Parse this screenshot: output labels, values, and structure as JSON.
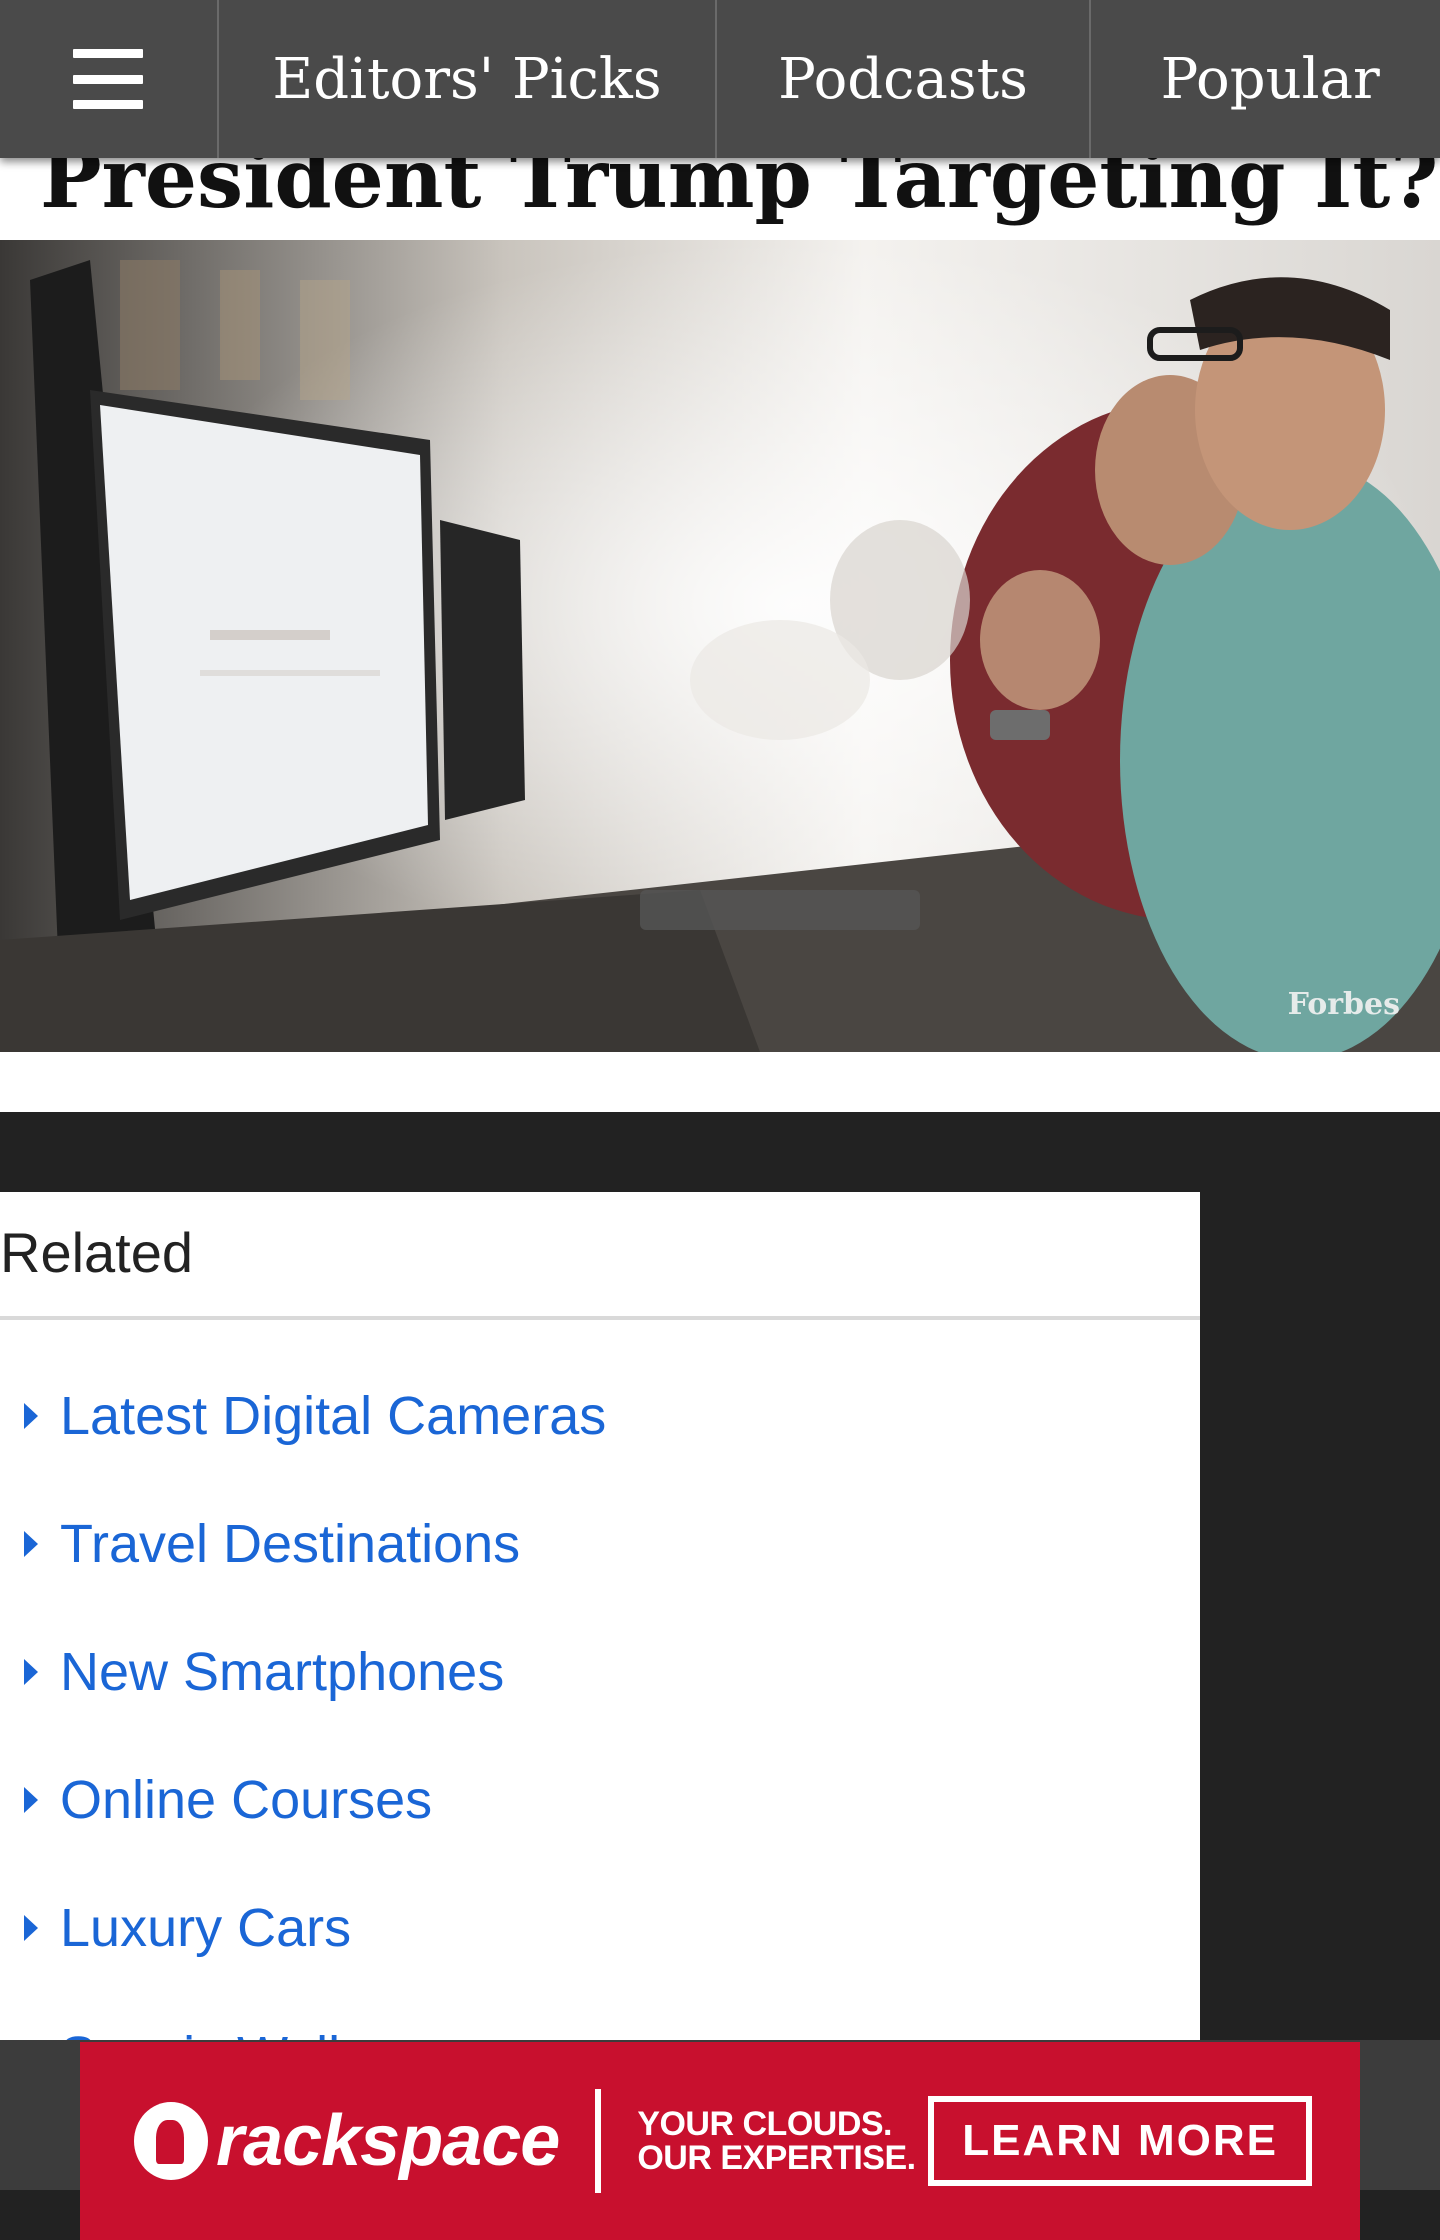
{
  "nav": {
    "menu_icon": "hamburger-menu-icon",
    "tabs": [
      {
        "label": "Editors' Picks"
      },
      {
        "label": "Podcasts"
      },
      {
        "label": "Popular"
      }
    ]
  },
  "article": {
    "headline": "President Trump Targeting It?",
    "hero_credit": "Forbes"
  },
  "related": {
    "title": "Related",
    "items": [
      {
        "label": "Latest Digital Cameras"
      },
      {
        "label": "Travel Destinations"
      },
      {
        "label": "New Smartphones"
      },
      {
        "label": "Online Courses"
      },
      {
        "label": "Luxury Cars"
      },
      {
        "label": "Scenic Wallpapers"
      }
    ],
    "link_color": "#1a66d6"
  },
  "ad": {
    "brand": "rackspace",
    "tagline_line1": "YOUR CLOUDS.",
    "tagline_line2": "OUR EXPERTISE.",
    "cta": "LEARN MORE",
    "color": "#c8102e"
  }
}
